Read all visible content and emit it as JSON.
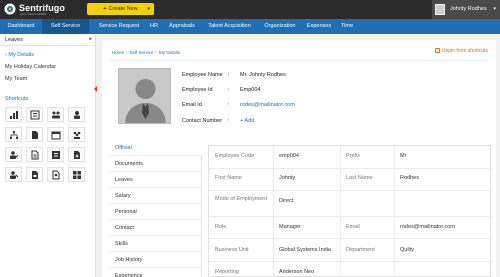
{
  "app": {
    "logo_name": "Sentrifugo",
    "logo_tag": "open source HRMS",
    "create_label": "Create New",
    "user_name": "Johnty Rodhes"
  },
  "nav": [
    "Dashboard",
    "Self Service",
    "Service Request",
    "HR",
    "Appraisals",
    "Talent Acquisition",
    "Organization",
    "Expenses",
    "Time"
  ],
  "sidebar": {
    "header": "Leaves",
    "links": [
      "My Details",
      "My Holiday Calendar",
      "My Team"
    ],
    "shortcuts_title": "Shortcuts",
    "shortcut_icons": [
      "org-chart-icon",
      "employee-list-icon",
      "user-group-icon",
      "team-icon",
      "hierarchy-icon",
      "document-icon",
      "calendar-icon",
      "people-icon",
      "user-check-icon",
      "report-icon",
      "list-icon",
      "doc-add-icon",
      "user-edit-icon",
      "doc-icon",
      "doc-user-icon",
      "grid-icon"
    ]
  },
  "breadcrumb": [
    "Home",
    "Self Service",
    "My Details"
  ],
  "unpin_label": "Unpin from shortcuts",
  "profile": {
    "rows": [
      {
        "label": "Employee Name",
        "value": "Mr. Johnty Rodhes"
      },
      {
        "label": "Employee Id",
        "value": "Emp004"
      },
      {
        "label": "Email Id",
        "value": "rodes@mailinator.com"
      },
      {
        "label": "Contact Number",
        "value": "+ Add"
      }
    ]
  },
  "tabs": [
    "Official",
    "Documents",
    "Leaves",
    "Salary",
    "Personal",
    "Contact",
    "Skills",
    "Job History",
    "Experience"
  ],
  "details": {
    "rows": [
      [
        "Employee Code",
        "emp004",
        "Prefix",
        "Mr"
      ],
      [
        "First Name",
        "Johnty",
        "Last Name",
        "Rodhes"
      ],
      [
        "Mode of Employment",
        "Direct",
        "",
        ""
      ],
      [
        "Role",
        "Manager",
        "Email",
        "rodes@mailinator.com"
      ],
      [
        "Business Unit",
        "Global Systems India",
        "Department",
        "Quilty"
      ],
      [
        "Reporting",
        "Anderson Neo",
        "",
        ""
      ]
    ]
  },
  "colors": {
    "nav_bg": "#1f6fb2",
    "topbar_bg": "#2b2b2b",
    "create_btn": "#f6d000",
    "accent_orange": "#e66b1a"
  }
}
